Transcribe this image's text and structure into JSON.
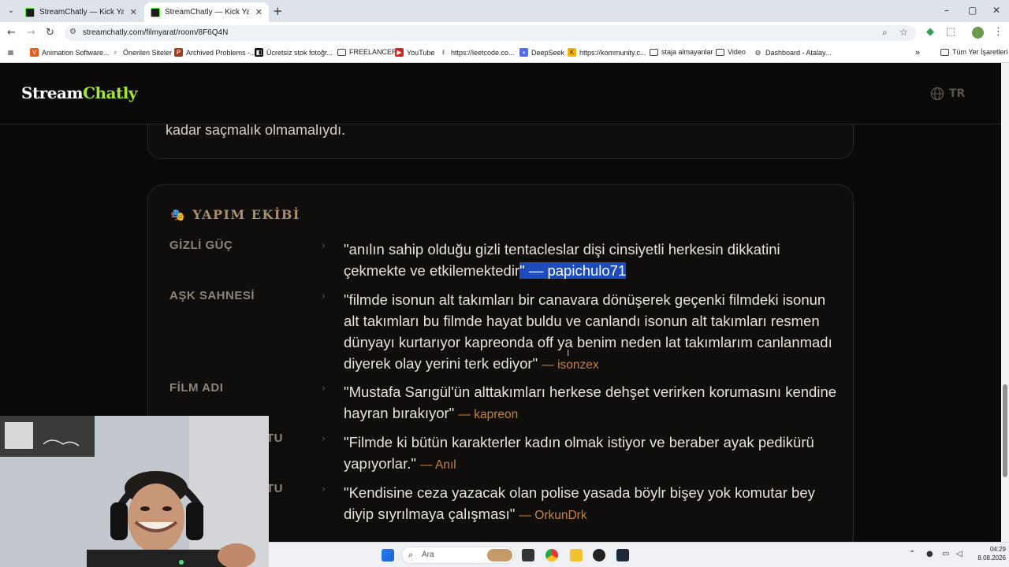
{
  "browser": {
    "tabs": [
      {
        "title": "StreamChatly — Kick Yayıncıları"
      },
      {
        "title": "StreamChatly — Kick Yayıncıları"
      }
    ],
    "url": "streamchatly.com/filmyarat/room/8F6Q4N",
    "bookmarks": [
      {
        "label": "Animation Software..."
      },
      {
        "label": "Önerilen Siteler"
      },
      {
        "label": "Archived Problems -..."
      },
      {
        "label": "Ücretsiz stok fotoğr..."
      },
      {
        "label": "FREELANCER"
      },
      {
        "label": "YouTube"
      },
      {
        "label": "https://leetcode.co..."
      },
      {
        "label": "DeepSeek"
      },
      {
        "label": "https://kommunity.c..."
      },
      {
        "label": "staja almayanlar"
      },
      {
        "label": "Video"
      },
      {
        "label": "Dashboard - Atalay..."
      }
    ],
    "all_bookmarks": "Tüm Yer İşaretleri"
  },
  "site": {
    "logo_part1": "Stream",
    "logo_part2": "Chatly",
    "language": "TR",
    "prev_card_text": "kadar saçmalık olmamalıydı.",
    "section_title": "YAPIM EKİBİ",
    "rows": [
      {
        "label": "GİZLİ GÜÇ",
        "text_line1": "\"anılın sahip olduğu gizli tentacleslar dişi cinsiyetli herkesin dikkatini",
        "text_line2": "çekmekte ve etkilemektedir",
        "selected": "\" — papichulo71"
      },
      {
        "label": "AŞK SAHNESİ",
        "text": "\"filmde isonun alt takımları bir canavara dönüşerek geçenki filmdeki isonun alt takımları bu filmde hayat buldu ve canlandı isonun alt takımları resmen dünyayı kurtarıyor kapreonda off ya benim neden lat takımlarım canlanmadı diyerek olay yerini terk ediyor\"",
        "author": "— isonzex"
      },
      {
        "label": "FİLM ADI",
        "text": "\"Mustafa Sarıgül'ün alttakımları herkese dehşet verirken korumasını kendine hayran bırakıyor\"",
        "author": "— kapreon"
      },
      {
        "label": "TU",
        "text": "\"Filmde ki bütün karakterler kadın olmak istiyor ve beraber ayak pedikürü yapıyorlar.\"",
        "author": "— Anıl"
      },
      {
        "label": "TU",
        "text": "\"Kendisine ceza yazacak olan polise yasada böylr bişey yok komutar bey diyip sıyrılmaya çalışması\"",
        "author": "— OrkunDrk"
      }
    ]
  },
  "taskbar": {
    "search_placeholder": "Ara",
    "time": "04:29",
    "date": "8.08.2026"
  }
}
